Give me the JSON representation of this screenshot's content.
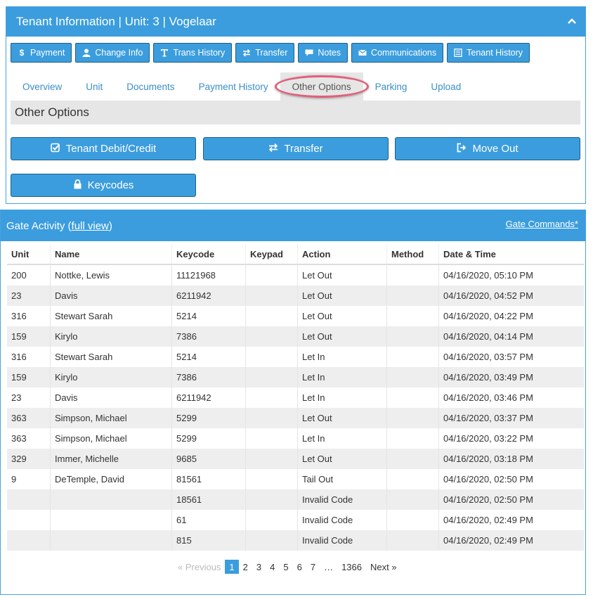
{
  "tenant_panel": {
    "title": "Tenant Information | Unit: 3 | Vogelaar",
    "actions": [
      {
        "label": "Payment",
        "icon": "$"
      },
      {
        "label": "Change Info",
        "icon": "user-icon"
      },
      {
        "label": "Trans History",
        "icon": "T"
      },
      {
        "label": "Transfer",
        "icon": "arrows-icon"
      },
      {
        "label": "Notes",
        "icon": "comment-icon"
      },
      {
        "label": "Communications",
        "icon": "envelope-icon"
      },
      {
        "label": "Tenant History",
        "icon": "list-icon"
      }
    ],
    "tabs": [
      "Overview",
      "Unit",
      "Documents",
      "Payment History",
      "Other Options",
      "Parking",
      "Upload"
    ],
    "active_tab": "Other Options",
    "section_title": "Other Options",
    "buttons": {
      "debit_credit": "Tenant Debit/Credit",
      "transfer": "Transfer",
      "move_out": "Move Out",
      "keycodes": "Keycodes"
    }
  },
  "gate_panel": {
    "title": "Gate Activity (",
    "title_link": "full view",
    "title_close": ")",
    "commands_link": "Gate Commands*",
    "columns": [
      "Unit",
      "Name",
      "Keycode",
      "Keypad",
      "Action",
      "Method",
      "Date & Time"
    ],
    "rows": [
      [
        "200",
        "Nottke, Lewis",
        "11121968",
        "",
        "Let Out",
        "",
        "04/16/2020, 05:10 PM"
      ],
      [
        "23",
        "Davis",
        "6211942",
        "",
        "Let Out",
        "",
        "04/16/2020, 04:52 PM"
      ],
      [
        "316",
        "Stewart Sarah",
        "5214",
        "",
        "Let Out",
        "",
        "04/16/2020, 04:22 PM"
      ],
      [
        "159",
        "Kirylo",
        "7386",
        "",
        "Let Out",
        "",
        "04/16/2020, 04:14 PM"
      ],
      [
        "316",
        "Stewart Sarah",
        "5214",
        "",
        "Let In",
        "",
        "04/16/2020, 03:57 PM"
      ],
      [
        "159",
        "Kirylo",
        "7386",
        "",
        "Let In",
        "",
        "04/16/2020, 03:49 PM"
      ],
      [
        "23",
        "Davis",
        "6211942",
        "",
        "Let In",
        "",
        "04/16/2020, 03:46 PM"
      ],
      [
        "363",
        "Simpson, Michael",
        "5299",
        "",
        "Let Out",
        "",
        "04/16/2020, 03:37 PM"
      ],
      [
        "363",
        "Simpson, Michael",
        "5299",
        "",
        "Let In",
        "",
        "04/16/2020, 03:22 PM"
      ],
      [
        "329",
        "Immer, Michelle",
        "9685",
        "",
        "Let Out",
        "",
        "04/16/2020, 03:18 PM"
      ],
      [
        "9",
        "DeTemple, David",
        "81561",
        "",
        "Tail Out",
        "",
        "04/16/2020, 02:50 PM"
      ],
      [
        "",
        "",
        "18561",
        "",
        "Invalid Code",
        "",
        "04/16/2020, 02:50 PM"
      ],
      [
        "",
        "",
        "61",
        "",
        "Invalid Code",
        "",
        "04/16/2020, 02:49 PM"
      ],
      [
        "",
        "",
        "815",
        "",
        "Invalid Code",
        "",
        "04/16/2020, 02:49 PM"
      ]
    ],
    "pager": {
      "previous": "« Previous",
      "pages": [
        "1",
        "2",
        "3",
        "4",
        "5",
        "6",
        "7",
        "…",
        "1366"
      ],
      "current": "1",
      "next": "Next »"
    }
  },
  "colors": {
    "header_blue": "#3b9ddd",
    "highlight_ring": "#e0607a",
    "tab_link": "#3b8fc8"
  }
}
